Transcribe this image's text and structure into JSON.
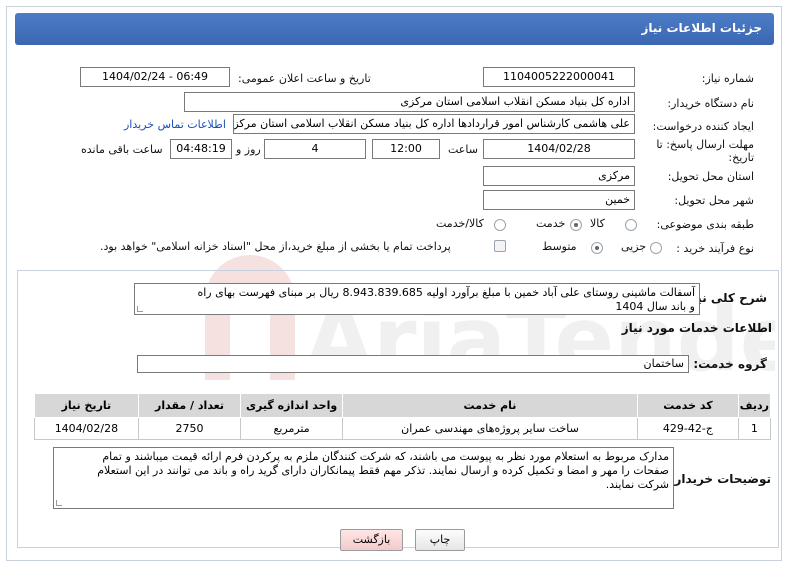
{
  "header": {
    "title": "جزئیات اطلاعات نیاز"
  },
  "watermark": {
    "text": "AriaTender.neT"
  },
  "form": {
    "need_number_label": "شماره نیاز:",
    "need_number": "1104005222000041",
    "announce_datetime_label": "تاریخ و ساعت اعلان عمومی:",
    "announce_datetime": "1404/02/24 - 06:49",
    "buyer_org_label": "نام دستگاه خریدار:",
    "buyer_org": "اداره کل بنیاد مسکن انقلاب اسلامی استان مرکزی",
    "requester_label": "ایجاد کننده درخواست:",
    "requester": "علی هاشمی کارشناس امور قراردادها اداره کل بنیاد مسکن انقلاب اسلامی استان مرکزی",
    "buyer_contact_link": "اطلاعات تماس خریدار",
    "deadline_label_1": "مهلت ارسال پاسخ: تا",
    "deadline_label_2": "تاریخ:",
    "deadline_date": "1404/02/28",
    "time_label": "ساعت",
    "deadline_time": "12:00",
    "days_value": "4",
    "days_label": "روز و",
    "remaining_time": "04:48:19",
    "remaining_label": "ساعت باقی مانده",
    "province_label": "استان محل تحویل:",
    "province": "مرکزی",
    "city_label": "شهر محل تحویل:",
    "city": "خمین",
    "category_label": "طبقه بندی موضوعی:",
    "category_options": [
      "کالا",
      "خدمت",
      "کالا/خدمت"
    ],
    "category_selected": "خدمت",
    "process_label": "نوع فرآیند خرید :",
    "process_options": [
      "جزیی",
      "متوسط"
    ],
    "process_selected": "متوسط",
    "treasury_note": "پرداخت تمام یا بخشی از مبلغ خرید،از محل \"اسناد خزانه اسلامی\" خواهد بود."
  },
  "need": {
    "summary_label": "شرح کلی نیاز:",
    "summary_line1": "آسفالت ماشینی روستای علی آباد خمین  با مبلغ برآورد اولیه  8.943.839.685 ریال بر مبنای فهرست بهای راه",
    "summary_line2": "و باند سال 1404",
    "services_title": "اطلاعات خدمات مورد نیاز",
    "service_group_label": "گروه خدمت:",
    "service_group": "ساختمان"
  },
  "table": {
    "headers": [
      "ردیف",
      "کد خدمت",
      "نام خدمت",
      "واحد اندازه گیری",
      "تعداد / مقدار",
      "تاریخ نیاز"
    ],
    "rows": [
      [
        "1",
        "ج-42-429",
        "ساخت سایر پروژه‌های مهندسی عمران",
        "مترمربع",
        "2750",
        "1404/02/28"
      ]
    ]
  },
  "buyer_notes": {
    "label": "توضیحات خریدار:",
    "line1": "مدارک مربوط به استعلام مورد نظر به پیوست می باشند، که شرکت کنندگان ملزم به پرکردن فرم ارائه قیمت میباشند و تمام",
    "line2": "صفحات را مهر و امضا و تکمیل کرده و ارسال نمایند. تذکر مهم فقط پیمانکاران دارای گرید راه و باند می توانند در این استعلام",
    "line3": "شرکت نمایند."
  },
  "buttons": {
    "print": "چاپ",
    "back": "بازگشت"
  }
}
